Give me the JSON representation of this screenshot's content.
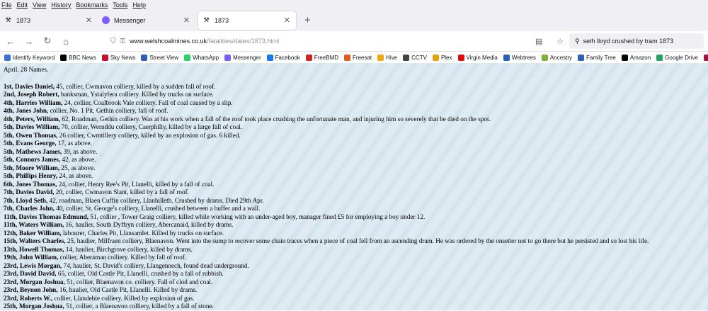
{
  "menu": [
    "File",
    "Edit",
    "View",
    "History",
    "Bookmarks",
    "Tools",
    "Help"
  ],
  "tabs": [
    {
      "title": "1873",
      "active": false
    },
    {
      "title": "Messenger",
      "active": false
    },
    {
      "title": "1873",
      "active": true
    }
  ],
  "nav": {
    "url_host": "www.welshcoalmines.co.uk",
    "url_path": "/fatalities/dates/1873.html",
    "search_value": "seth lloyd crushed by tram 1873"
  },
  "bookmarks": [
    {
      "label": "Identify Keyword",
      "color": "#3b73d9"
    },
    {
      "label": "BBC News",
      "color": "#000000"
    },
    {
      "label": "Sky News",
      "color": "#c8102e"
    },
    {
      "label": "Street View",
      "color": "#2c5fb8"
    },
    {
      "label": "WhatsApp",
      "color": "#25d366"
    },
    {
      "label": "Messenger",
      "color": "#7b5cff"
    },
    {
      "label": "Facebook",
      "color": "#1877f2"
    },
    {
      "label": "FreeBMD",
      "color": "#d42222"
    },
    {
      "label": "Freesat",
      "color": "#e35b1c"
    },
    {
      "label": "Hive",
      "color": "#f3a712"
    },
    {
      "label": "CCTV",
      "color": "#444444"
    },
    {
      "label": "Plex",
      "color": "#e5a00d"
    },
    {
      "label": "Virgin Media",
      "color": "#e10a0a"
    },
    {
      "label": "Webtrees",
      "color": "#2c5fb8"
    },
    {
      "label": "Ancestry",
      "color": "#7fb23a"
    },
    {
      "label": "Family Tree",
      "color": "#2c5fb8"
    },
    {
      "label": "Amazon",
      "color": "#000000"
    },
    {
      "label": "Google Drive",
      "color": "#1fa463"
    },
    {
      "label": "Notebooks",
      "color": "#a4123f"
    }
  ],
  "page": {
    "heading": "April. 28 Names.",
    "entries": [
      {
        "name": "1st, Davies Daniel,",
        "text": " 45, collier, Cwmavon colliery, killed by a sudden fall of roof."
      },
      {
        "name": "2nd, Joseph Robert,",
        "text": " banksman, Ystalyfera colliery. Killed by trucks on surface."
      },
      {
        "name": "4th, Harries William,",
        "text": " 24, collier, Coalbrook Vale colliery. Fall of coal caused by a slip."
      },
      {
        "name": "4th, Jones John,",
        "text": " collier, No. 1 Pit, Gethin colliery, fall of roof."
      },
      {
        "name": "4th, Peters, William,",
        "text": " 62, Roadman, Gethin colliery. Was at his work when a fall of the roof took place crushing the unfortunate man, and injuring him so severely that he died on the spot."
      },
      {
        "name": "5th, Davies William,",
        "text": " 70, collier, Wernddu colliery, Caerphilly, killed by a large fall of coal."
      },
      {
        "name": "5th, Owen Thomas,",
        "text": " 26 collier, Cwmtillery colliery, killed by an explosion of gas. 6 killed."
      },
      {
        "name": "5th, Evans George,",
        "text": " 17, as above."
      },
      {
        "name": "5th, Mathews James,",
        "text": " 39, as above."
      },
      {
        "name": "5th, Connors James,",
        "text": " 42, as above."
      },
      {
        "name": "5th, Moore William,",
        "text": " 25, as above."
      },
      {
        "name": "5th, Phillips Henry,",
        "text": " 24, as above."
      },
      {
        "name": "6th, Jones Thomas,",
        "text": " 24, collier, Henry Ree's Pit, Llanelli, killed by a fall of coal."
      },
      {
        "name": "7th, Davies David,",
        "text": " 20, collier, Cwmavon Slant, killed by a fall of roof."
      },
      {
        "name": "7th, Lloyd Seth,",
        "text": " 42, roadman, Blaen Cuffin colliery, Llanhilleth. Crushed by drams. Died 29th Apr."
      },
      {
        "name": "7th, Charles John,",
        "text": " 40, collier, St. George's colliery, Llanelli, crushed between a buffer and a wall."
      },
      {
        "name": "11th, Davies Thomas Edmund,",
        "text": " 51, collier , Tower Graig colliery, killed while working with an under-aged boy, manager fined £5 for employing a boy under 12."
      },
      {
        "name": "11th, Waters William,",
        "text": " 16, haulier, South Dyffryn colliery, Abercanaid, killed by drams."
      },
      {
        "name": "12th, Baker William,",
        "text": " labourer, Charles Pit, Llansamlet. Killed by trucks on surface."
      },
      {
        "name": "15th, Walters Charles,",
        "text": " 25, haulier, Milfraen colliery, Blaenavon. Went into the sump to recover some chain traces when a piece of coal fell from an ascending dram. He was ordered by the onsetter not to go there but he persisted and so lost his life."
      },
      {
        "name": "13th, Howell Thomas,",
        "text": " 14, haulier, Birchgrove colliery, killed by drams."
      },
      {
        "name": "19th, John William,",
        "text": " collier, Aberaman colliery. Killed by fall of roof."
      },
      {
        "name": "23rd, Lewis Morgan,",
        "text": " 74, haulier, St. David's colliery, Llangennech, found dead underground."
      },
      {
        "name": "23rd, David David,",
        "text": " 65, collier, Old Castle Pit, Llanelli, crushed by a fall of rubbish."
      },
      {
        "name": "23rd, Morgan Joshua,",
        "text": " 51, collier, Blaenavon co. colliery. Fall of clod and coal."
      },
      {
        "name": "23rd, Beynon John,",
        "text": " 16, haulier, Old Castle Pit, Llanelli. Killed by drams."
      },
      {
        "name": "23rd, Roberts W.,",
        "text": " collier, Llandebie colliery. Killed by explosion of gas."
      },
      {
        "name": "25th, Morgan Joshua,",
        "text": " 51, collier, a Blaenavon colliery, killed by a fall of stone."
      }
    ]
  }
}
